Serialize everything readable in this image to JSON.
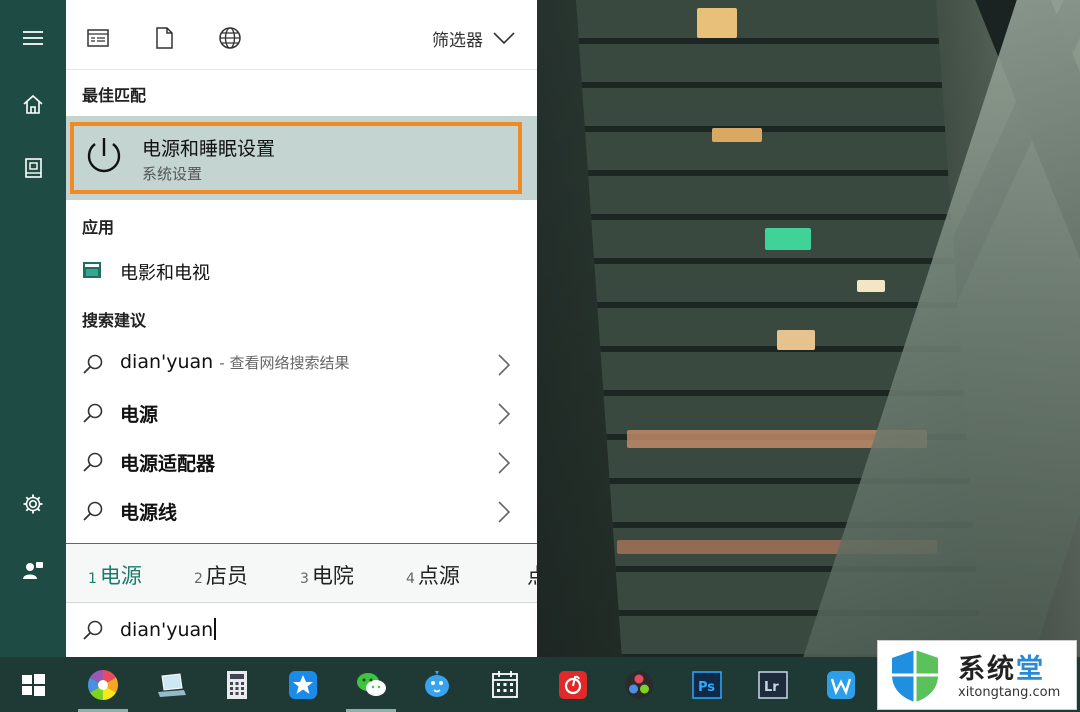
{
  "toolbar": {
    "filter_label": "筛选器",
    "icons": [
      "document-list-icon",
      "file-icon",
      "globe-icon"
    ]
  },
  "sections": {
    "best_match": "最佳匹配",
    "apps": "应用",
    "suggestions": "搜索建议"
  },
  "best_match": {
    "title": "电源和睡眠设置",
    "subtitle": "系统设置",
    "highlight_color": "#f08a24"
  },
  "apps": [
    {
      "label": "电影和电视"
    }
  ],
  "suggestions": [
    {
      "text": "dian'yuan",
      "hint": "- 查看网络搜索结果"
    },
    {
      "text": "电源",
      "hint": ""
    },
    {
      "text": "电源适配器",
      "hint": ""
    },
    {
      "text": "电源线",
      "hint": ""
    }
  ],
  "ime": {
    "candidates": [
      {
        "num": "1",
        "text": "电源"
      },
      {
        "num": "2",
        "text": "店员"
      },
      {
        "num": "3",
        "text": "电院"
      },
      {
        "num": "4",
        "text": "点源"
      },
      {
        "num": "",
        "text": "点"
      }
    ]
  },
  "search": {
    "value": "dian'yuan"
  },
  "watermark": {
    "title_a": "系统",
    "title_b": "堂",
    "url": "xitongtang.com"
  },
  "colors": {
    "rail": "#1e4b43",
    "taskbar": "#1f3a35",
    "accent": "#1f7a6a"
  }
}
